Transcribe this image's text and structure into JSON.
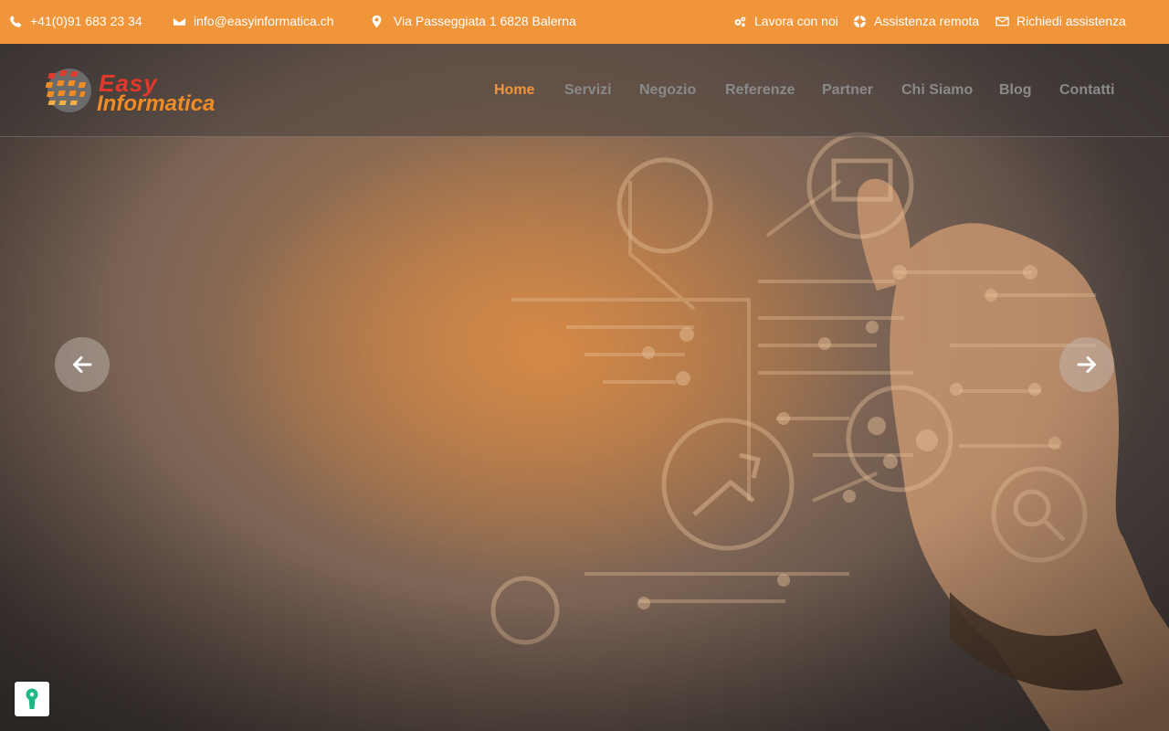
{
  "topbar": {
    "phone": "+41(0)91 683 23 34",
    "email": "info@easyinformatica.ch",
    "address": "Via Passeggiata 1 6828 Balerna",
    "work_with_us": "Lavora con noi",
    "remote_support": "Assistenza remota",
    "request_support": "Richiedi assistenza",
    "background_color": "#f0953a"
  },
  "brand": {
    "line1": "Easy",
    "line2": "Informatica",
    "color_red": "#e2392c",
    "color_orange": "#f08c25"
  },
  "nav": {
    "items": [
      "Home",
      "Servizi",
      "Negozio",
      "Referenze",
      "Partner",
      "Chi Siamo",
      "Blog",
      "Contatti"
    ],
    "active": "Home",
    "active_color": "#f0953a"
  },
  "slider": {
    "prev_icon": "arrow-left-icon",
    "next_icon": "arrow-right-icon"
  },
  "cookie_widget": {
    "icon": "keyhole-icon",
    "color": "#1db886"
  }
}
